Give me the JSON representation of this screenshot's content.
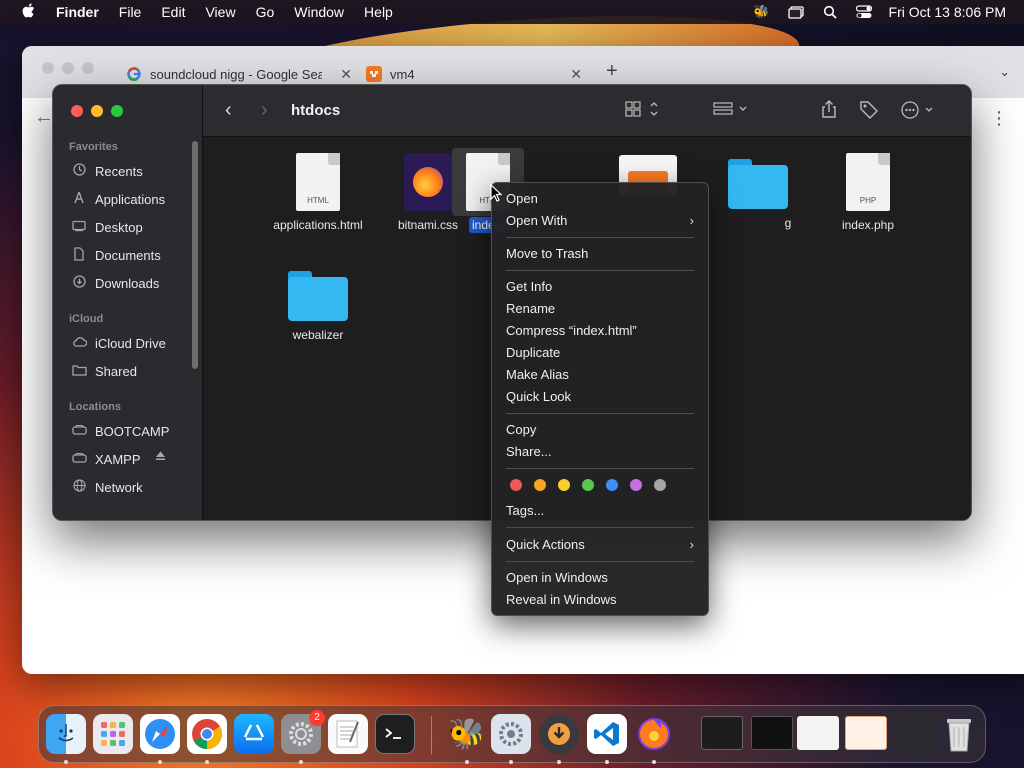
{
  "menubar": {
    "apple": "",
    "items": [
      "Finder",
      "File",
      "Edit",
      "View",
      "Go",
      "Window",
      "Help"
    ],
    "clock": "Fri Oct 13  8:06 PM",
    "icons": [
      "bee-icon",
      "screen-mirror-icon",
      "spotlight-icon",
      "control-center-icon"
    ]
  },
  "chrome": {
    "tabs": [
      {
        "title": "soundcloud nigg - Google Sea",
        "favicon": "google-icon",
        "close": "✕"
      },
      {
        "title": "vm4",
        "favicon": "xampp-icon",
        "close": "✕"
      }
    ],
    "new_tab": "+",
    "tab_menu": "⌄",
    "more": "⋮",
    "back": "←"
  },
  "finder": {
    "title": "htdocs",
    "back": "‹",
    "forward": "›",
    "sidebar": {
      "favorites_label": "Favorites",
      "favorites": [
        {
          "label": "Recents",
          "icon": "clock-icon"
        },
        {
          "label": "Applications",
          "icon": "applications-icon"
        },
        {
          "label": "Desktop",
          "icon": "desktop-icon"
        },
        {
          "label": "Documents",
          "icon": "document-icon"
        },
        {
          "label": "Downloads",
          "icon": "download-icon"
        }
      ],
      "icloud_label": "iCloud",
      "icloud": [
        {
          "label": "iCloud Drive",
          "icon": "cloud-icon"
        },
        {
          "label": "Shared",
          "icon": "shared-folder-icon"
        }
      ],
      "locations_label": "Locations",
      "locations": [
        {
          "label": "BOOTCAMP",
          "icon": "drive-icon"
        },
        {
          "label": "XAMPP",
          "icon": "drive-icon"
        },
        {
          "label": "Network",
          "icon": "network-icon"
        }
      ]
    },
    "files": [
      {
        "name": "applications.html",
        "kind": "HTML"
      },
      {
        "name": "bitnami.css",
        "kind": "firefox"
      },
      {
        "name": "index.",
        "kind": "HTM",
        "selected": true
      },
      {
        "name": "",
        "kind": "xampp"
      },
      {
        "name": "g",
        "kind": "folder"
      },
      {
        "name": "index.php",
        "kind": "PHP"
      },
      {
        "name": "webalizer",
        "kind": "folder"
      }
    ]
  },
  "context_menu": {
    "items": {
      "open": "Open",
      "open_with": "Open With",
      "move_to_trash": "Move to Trash",
      "get_info": "Get Info",
      "rename": "Rename",
      "compress": "Compress “index.html”",
      "duplicate": "Duplicate",
      "make_alias": "Make Alias",
      "quick_look": "Quick Look",
      "copy": "Copy",
      "share": "Share...",
      "tags": "Tags...",
      "quick_actions": "Quick Actions",
      "open_in_windows": "Open in Windows",
      "reveal_in_windows": "Reveal in Windows"
    },
    "submenu_arrow": "›",
    "tag_colors": [
      "#ec5a55",
      "#f5a623",
      "#f5d02c",
      "#5ac84f",
      "#3d8ff5",
      "#c66fe0",
      "#a5a5a8"
    ]
  },
  "dock": {
    "badge_settings": "2",
    "apps": [
      "finder-icon",
      "launchpad-icon",
      "safari-icon",
      "chrome-icon",
      "app-store-icon",
      "system-settings-icon",
      "textedit-icon",
      "terminal-icon",
      "bee-app-icon",
      "utility-icon",
      "downloader-icon",
      "vscode-icon",
      "firefox-icon"
    ],
    "recents": [
      "terminal-window-thumb",
      "terminal-window-thumb-2",
      "document-thumb",
      "xampp-thumb",
      "vscode-window-thumb"
    ],
    "trash": "trash-icon"
  }
}
